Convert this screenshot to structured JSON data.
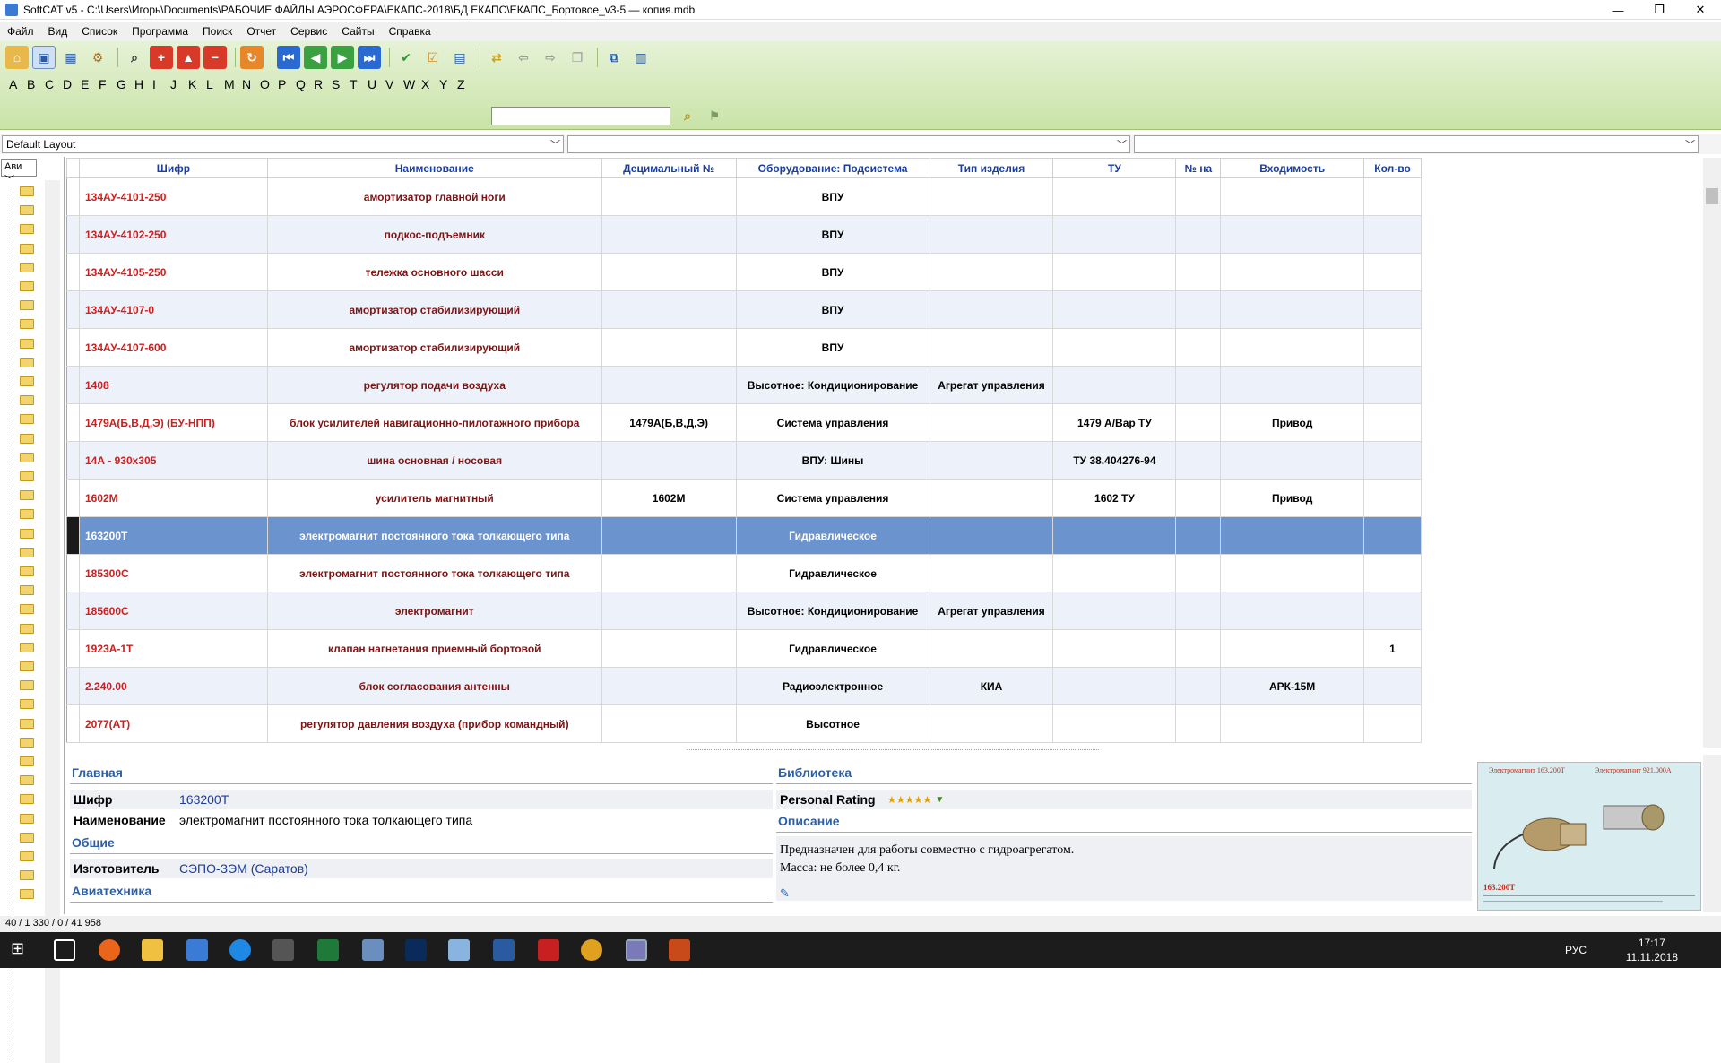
{
  "window": {
    "title": "SoftCAT v5 - C:\\Users\\Игорь\\Documents\\РАБОЧИЕ ФАЙЛЫ АЭРОСФЕРА\\ЕКАПС-2018\\БД ЕКАПС\\ЕКАПС_Бортовое_v3-5 — копия.mdb",
    "minimize": "—",
    "maximize": "❐",
    "close": "✕"
  },
  "menu": [
    "Файл",
    "Вид",
    "Список",
    "Программа",
    "Поиск",
    "Отчет",
    "Сервис",
    "Сайты",
    "Справка"
  ],
  "alphabet": [
    "A",
    "B",
    "C",
    "D",
    "E",
    "F",
    "G",
    "H",
    "I",
    "J",
    "K",
    "L",
    "M",
    "N",
    "O",
    "P",
    "Q",
    "R",
    "S",
    "T",
    "U",
    "V",
    "W",
    "X",
    "Y",
    "Z"
  ],
  "layout_combo": "Default Layout",
  "left_combo": "Ави",
  "columns": [
    "Шифр",
    "Наименование",
    "Децимальный №",
    "Оборудование: Подсистема",
    "Тип изделия",
    "ТУ",
    "№ на",
    "Входимость",
    "Кол-во"
  ],
  "rows": [
    {
      "code": "134АУ-4101-250",
      "name": "амортизатор главной ноги",
      "dec": "",
      "equip": "ВПУ",
      "type": "",
      "tu": "",
      "no": "",
      "inc": "",
      "qty": ""
    },
    {
      "code": "134АУ-4102-250",
      "name": "подкос-подъемник",
      "dec": "",
      "equip": "ВПУ",
      "type": "",
      "tu": "",
      "no": "",
      "inc": "",
      "qty": ""
    },
    {
      "code": "134АУ-4105-250",
      "name": "тележка основного шасси",
      "dec": "",
      "equip": "ВПУ",
      "type": "",
      "tu": "",
      "no": "",
      "inc": "",
      "qty": ""
    },
    {
      "code": "134АУ-4107-0",
      "name": "амортизатор стабилизирующий",
      "dec": "",
      "equip": "ВПУ",
      "type": "",
      "tu": "",
      "no": "",
      "inc": "",
      "qty": ""
    },
    {
      "code": "134АУ-4107-600",
      "name": "амортизатор стабилизирующий",
      "dec": "",
      "equip": "ВПУ",
      "type": "",
      "tu": "",
      "no": "",
      "inc": "",
      "qty": ""
    },
    {
      "code": "1408",
      "name": "регулятор подачи воздуха",
      "dec": "",
      "equip": "Высотное: Кондиционирование",
      "type": "Агрегат управления",
      "tu": "",
      "no": "",
      "inc": "",
      "qty": ""
    },
    {
      "code": "1479А(Б,В,Д,Э) (БУ-НПП)",
      "name": "блок усилителей навигационно-пилотажного прибора",
      "dec": "1479А(Б,В,Д,Э)",
      "equip": "Система управления",
      "type": "",
      "tu": "1479 А/Вар ТУ",
      "no": "",
      "inc": "Привод",
      "qty": ""
    },
    {
      "code": "14А - 930х305",
      "name": "шина основная / носовая",
      "dec": "",
      "equip": "ВПУ: Шины",
      "type": "",
      "tu": "ТУ 38.404276-94",
      "no": "",
      "inc": "",
      "qty": ""
    },
    {
      "code": "1602М",
      "name": "усилитель магнитный",
      "dec": "1602М",
      "equip": "Система управления",
      "type": "",
      "tu": "1602 ТУ",
      "no": "",
      "inc": "Привод",
      "qty": ""
    },
    {
      "code": "163200Т",
      "name": "электромагнит постоянного тока толкающего типа",
      "dec": "",
      "equip": "Гидравлическое",
      "type": "",
      "tu": "",
      "no": "",
      "inc": "",
      "qty": "",
      "selected": true
    },
    {
      "code": "185300С",
      "name": "электромагнит постоянного тока толкающего типа",
      "dec": "",
      "equip": "Гидравлическое",
      "type": "",
      "tu": "",
      "no": "",
      "inc": "",
      "qty": ""
    },
    {
      "code": "185600С",
      "name": "электромагнит",
      "dec": "",
      "equip": "Высотное: Кондиционирование",
      "type": "Агрегат управления",
      "tu": "",
      "no": "",
      "inc": "",
      "qty": ""
    },
    {
      "code": "1923А-1Т",
      "name": "клапан нагнетания приемный бортовой",
      "dec": "",
      "equip": "Гидравлическое",
      "type": "",
      "tu": "",
      "no": "",
      "inc": "",
      "qty": "1"
    },
    {
      "code": "2.240.00",
      "name": "блок согласования антенны",
      "dec": "",
      "equip": "Радиоэлектронное",
      "type": "КИА",
      "tu": "",
      "no": "",
      "inc": "АРК-15М",
      "qty": ""
    },
    {
      "code": "2077(АТ)",
      "name": "регулятор давления воздуха (прибор командный)",
      "dec": "",
      "equip": "Высотное",
      "type": "",
      "tu": "",
      "no": "",
      "inc": "",
      "qty": ""
    }
  ],
  "detail": {
    "main_section": "Главная",
    "cipher_label": "Шифр",
    "cipher_value": "163200Т",
    "name_label": "Наименование",
    "name_value": "электромагнит постоянного тока толкающего типа",
    "general_section": "Общие",
    "maker_label": "Изготовитель",
    "maker_value": "СЭПО-ЗЭМ (Саратов)",
    "avia_section": "Авиатехника",
    "library_section": "Библиотека",
    "rating_label": "Personal Rating",
    "rating_stars": "★★★★★",
    "desc_section": "Описание",
    "desc_line1": "Предназначен для работы совместно с гидроагрегатом.",
    "desc_line2": "Масса: не более 0,4 кг.",
    "photo_caption1": "Электромагнит 163.200Т",
    "photo_caption2": "Электромагнит 921.000А",
    "photo_label": "163.200Т"
  },
  "status": "40 / 1 330 / 0 / 41 958",
  "taskbar": {
    "lang": "РУС",
    "time": "17:17",
    "date": "11.11.2018"
  }
}
